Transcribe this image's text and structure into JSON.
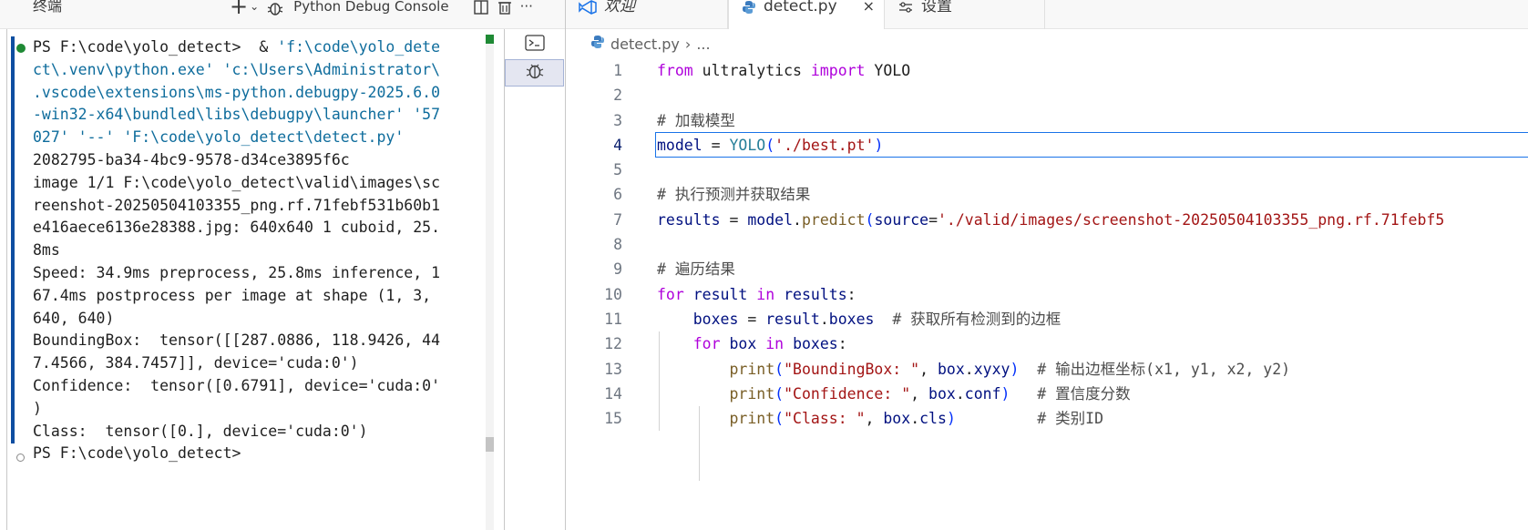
{
  "terminal": {
    "title": "终端",
    "debug_console_label": "Python Debug Console",
    "icons": [
      "plus-icon",
      "chevron-down-icon",
      "bug-icon",
      "split-icon",
      "trash-icon",
      "more-icon"
    ],
    "more_label": "···",
    "lines": [
      {
        "segs": [
          {
            "t": "PS F:\\code\\yolo_detect>  & "
          },
          {
            "t": "'f:\\code\\yolo_dete",
            "c": "str"
          }
        ]
      },
      {
        "segs": [
          {
            "t": "ct\\.venv\\python.exe' 'c:\\Users\\Administrator\\",
            "c": "str"
          }
        ]
      },
      {
        "segs": [
          {
            "t": ".vscode\\extensions\\ms-python.debugpy-2025.6.0",
            "c": "str"
          }
        ]
      },
      {
        "segs": [
          {
            "t": "-win32-x64\\bundled\\libs\\debugpy\\launcher' '57",
            "c": "str"
          }
        ]
      },
      {
        "segs": [
          {
            "t": "027' '--' 'F:\\code\\yolo_detect\\detect.py'",
            "c": "str"
          }
        ]
      },
      {
        "segs": [
          {
            "t": "2082795-ba34-4bc9-9578-d34ce3895f6c"
          }
        ]
      },
      {
        "segs": [
          {
            "t": "image 1/1 F:\\code\\yolo_detect\\valid\\images\\sc"
          }
        ]
      },
      {
        "segs": [
          {
            "t": "reenshot-20250504103355_png.rf.71febf531b60b1"
          }
        ]
      },
      {
        "segs": [
          {
            "t": "e416aece6136e28388.jpg: 640x640 1 cuboid, 25."
          }
        ]
      },
      {
        "segs": [
          {
            "t": "8ms"
          }
        ]
      },
      {
        "segs": [
          {
            "t": "Speed: 34.9ms preprocess, 25.8ms inference, 1"
          }
        ]
      },
      {
        "segs": [
          {
            "t": "67.4ms postprocess per image at shape (1, 3,"
          }
        ]
      },
      {
        "segs": [
          {
            "t": "640, 640)"
          }
        ]
      },
      {
        "segs": [
          {
            "t": "BoundingBox:  tensor([[287.0886, 118.9426, 44"
          }
        ]
      },
      {
        "segs": [
          {
            "t": "7.4566, 384.7457]], device='cuda:0')"
          }
        ]
      },
      {
        "segs": [
          {
            "t": "Confidence:  tensor([0.6791], device='cuda:0'"
          }
        ]
      },
      {
        "segs": [
          {
            "t": ")"
          }
        ]
      },
      {
        "segs": [
          {
            "t": "Class:  tensor([0.], device='cuda:0')"
          }
        ]
      },
      {
        "segs": [
          {
            "t": "PS F:\\code\\yolo_detect>"
          }
        ]
      }
    ]
  },
  "editor": {
    "tabs": [
      {
        "label": "欢迎",
        "icon": "vscode-icon"
      },
      {
        "label": "detect.py",
        "icon": "python-icon",
        "close": "×"
      },
      {
        "label": "设置",
        "icon": "settings-sliders-icon"
      }
    ],
    "breadcrumb": {
      "file": "detect.py",
      "sep": "›",
      "rest": "..."
    },
    "current_line": 4,
    "lines": [
      {
        "n": "1",
        "segs": [
          {
            "t": "from",
            "c": "kw"
          },
          {
            "t": " ultralytics "
          },
          {
            "t": "import",
            "c": "kw"
          },
          {
            "t": " YOLO"
          }
        ]
      },
      {
        "n": "2",
        "segs": []
      },
      {
        "n": "3",
        "segs": [
          {
            "t": "# 加载模型",
            "c": "cmt-zh"
          }
        ]
      },
      {
        "n": "4",
        "segs": [
          {
            "t": "model",
            "c": "var"
          },
          {
            "t": " = "
          },
          {
            "t": "YOLO",
            "c": "cls"
          },
          {
            "t": "(",
            "c": "brk1"
          },
          {
            "t": "'./best.pt'",
            "c": "str2"
          },
          {
            "t": ")",
            "c": "brk1"
          }
        ]
      },
      {
        "n": "5",
        "segs": []
      },
      {
        "n": "6",
        "segs": [
          {
            "t": "# 执行预测并获取结果",
            "c": "cmt-zh"
          }
        ]
      },
      {
        "n": "7",
        "segs": [
          {
            "t": "results",
            "c": "var"
          },
          {
            "t": " = "
          },
          {
            "t": "model",
            "c": "var"
          },
          {
            "t": "."
          },
          {
            "t": "predict",
            "c": "fn"
          },
          {
            "t": "(",
            "c": "brk1"
          },
          {
            "t": "source",
            "c": "var"
          },
          {
            "t": "="
          },
          {
            "t": "'./valid/images/screenshot-20250504103355_png.rf.71febf5",
            "c": "str2"
          }
        ]
      },
      {
        "n": "8",
        "segs": []
      },
      {
        "n": "9",
        "segs": [
          {
            "t": "# 遍历结果",
            "c": "cmt-zh"
          }
        ]
      },
      {
        "n": "10",
        "segs": [
          {
            "t": "for",
            "c": "kw"
          },
          {
            "t": " "
          },
          {
            "t": "result",
            "c": "var"
          },
          {
            "t": " "
          },
          {
            "t": "in",
            "c": "kw"
          },
          {
            "t": " "
          },
          {
            "t": "results",
            "c": "var"
          },
          {
            "t": ":"
          }
        ]
      },
      {
        "n": "11",
        "segs": [
          {
            "t": "    "
          },
          {
            "t": "boxes",
            "c": "var"
          },
          {
            "t": " = "
          },
          {
            "t": "result",
            "c": "var"
          },
          {
            "t": "."
          },
          {
            "t": "boxes",
            "c": "var"
          },
          {
            "t": "  "
          },
          {
            "t": "# 获取所有检测到的边框",
            "c": "cmt-zh"
          }
        ]
      },
      {
        "n": "12",
        "segs": [
          {
            "t": "    "
          },
          {
            "t": "for",
            "c": "kw"
          },
          {
            "t": " "
          },
          {
            "t": "box",
            "c": "var"
          },
          {
            "t": " "
          },
          {
            "t": "in",
            "c": "kw"
          },
          {
            "t": " "
          },
          {
            "t": "boxes",
            "c": "var"
          },
          {
            "t": ":"
          }
        ]
      },
      {
        "n": "13",
        "segs": [
          {
            "t": "        "
          },
          {
            "t": "print",
            "c": "fn"
          },
          {
            "t": "(",
            "c": "brk1"
          },
          {
            "t": "\"BoundingBox: \"",
            "c": "str2"
          },
          {
            "t": ", "
          },
          {
            "t": "box",
            "c": "var"
          },
          {
            "t": "."
          },
          {
            "t": "xyxy",
            "c": "var"
          },
          {
            "t": ")",
            "c": "brk1"
          },
          {
            "t": "  "
          },
          {
            "t": "# 输出边框坐标(x1, y1, x2, y2)",
            "c": "cmt-zh"
          }
        ]
      },
      {
        "n": "14",
        "segs": [
          {
            "t": "        "
          },
          {
            "t": "print",
            "c": "fn"
          },
          {
            "t": "(",
            "c": "brk1"
          },
          {
            "t": "\"Confidence: \"",
            "c": "str2"
          },
          {
            "t": ", "
          },
          {
            "t": "box",
            "c": "var"
          },
          {
            "t": "."
          },
          {
            "t": "conf",
            "c": "var"
          },
          {
            "t": ")",
            "c": "brk1"
          },
          {
            "t": "   "
          },
          {
            "t": "# 置信度分数",
            "c": "cmt-zh"
          }
        ]
      },
      {
        "n": "15",
        "segs": [
          {
            "t": "        "
          },
          {
            "t": "print",
            "c": "fn"
          },
          {
            "t": "(",
            "c": "brk1"
          },
          {
            "t": "\"Class: \"",
            "c": "str2"
          },
          {
            "t": ", "
          },
          {
            "t": "box",
            "c": "var"
          },
          {
            "t": "."
          },
          {
            "t": "cls",
            "c": "var"
          },
          {
            "t": ")",
            "c": "brk1"
          },
          {
            "t": "         "
          },
          {
            "t": "# 类别ID",
            "c": "cmt-zh"
          }
        ]
      }
    ]
  },
  "colors": {
    "accent": "#1a73e8",
    "run_bar": "#0e4ea1",
    "success_dot": "#1f8a35",
    "keyword": "#af00db",
    "string": "#a31515",
    "function": "#795e26"
  }
}
